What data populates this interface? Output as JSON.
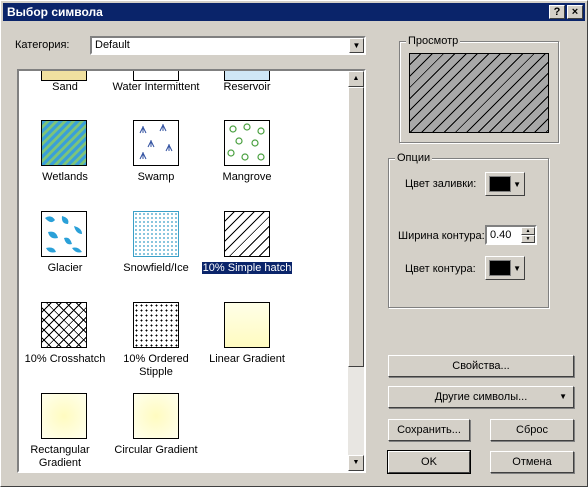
{
  "window": {
    "title": "Выбор символа",
    "help_btn": "?",
    "close_btn": "×"
  },
  "category": {
    "label": "Категория:",
    "value": "Default"
  },
  "symbols": [
    {
      "label": "Sand"
    },
    {
      "label": "Water Intermittent"
    },
    {
      "label": "Reservoir"
    },
    {
      "label": "Wetlands"
    },
    {
      "label": "Swamp"
    },
    {
      "label": "Mangrove"
    },
    {
      "label": "Glacier"
    },
    {
      "label": "Snowfield/Ice"
    },
    {
      "label": "10% Simple hatch"
    },
    {
      "label": "10% Crosshatch"
    },
    {
      "label": "10% Ordered Stipple"
    },
    {
      "label": "Linear Gradient"
    },
    {
      "label": "Rectangular Gradient"
    },
    {
      "label": "Circular Gradient"
    }
  ],
  "selected_symbol": "10% Simple hatch",
  "preview": {
    "title": "Просмотр"
  },
  "options": {
    "title": "Опции",
    "fill_color_label": "Цвет заливки:",
    "outline_width_label": "Ширина контура:",
    "outline_width_value": "0.40",
    "outline_color_label": "Цвет контура:",
    "fill_color": "#000000",
    "outline_color": "#000000"
  },
  "buttons": {
    "properties": "Свойства...",
    "more_symbols": "Другие символы...",
    "save": "Сохранить...",
    "reset": "Сброс",
    "ok": "OK",
    "cancel": "Отмена"
  }
}
